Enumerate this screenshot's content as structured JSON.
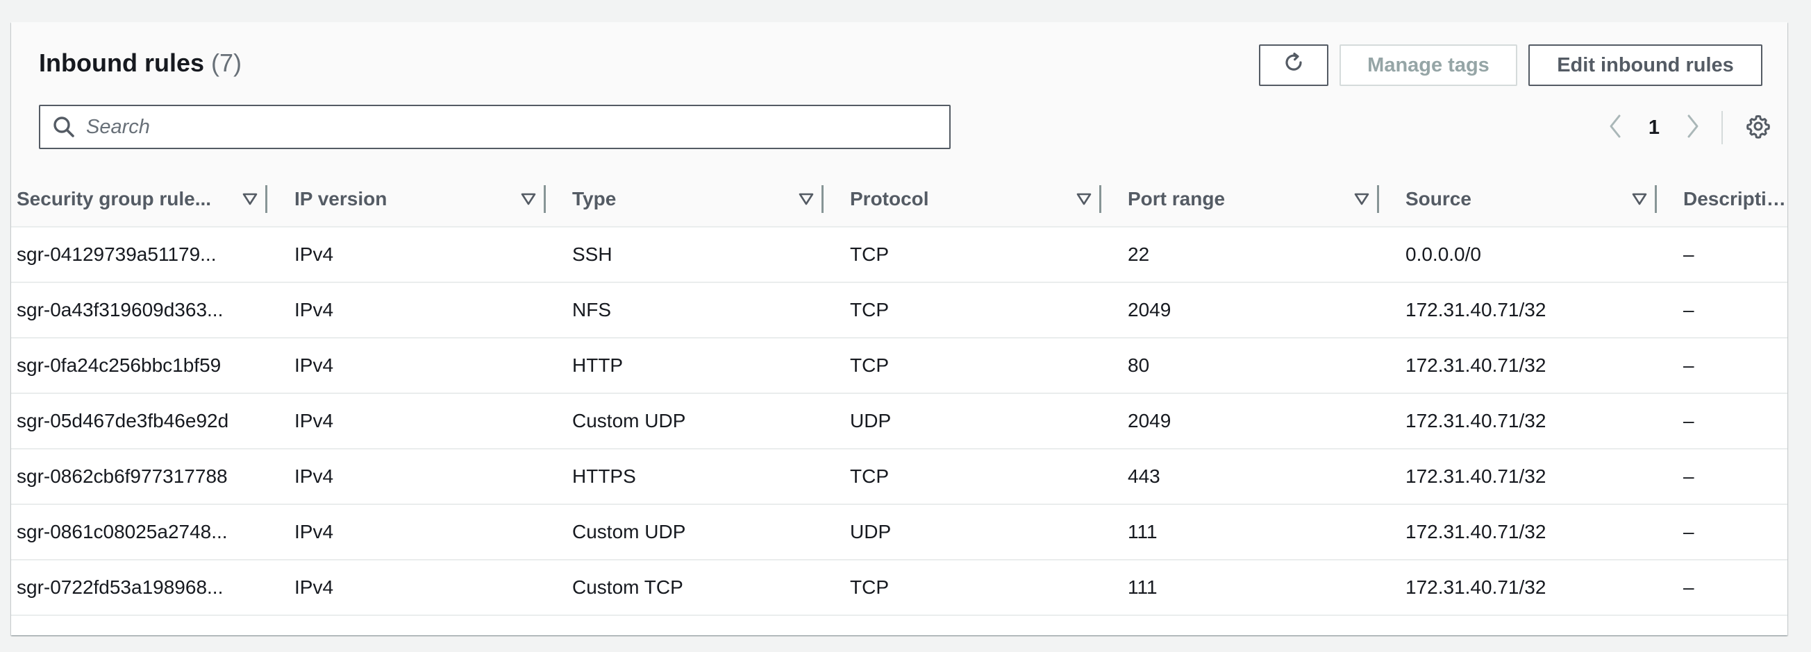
{
  "panel": {
    "title": "Inbound rules",
    "count": "(7)",
    "buttons": {
      "refresh_icon": "refresh-icon",
      "manage_tags": "Manage tags",
      "edit_inbound_rules": "Edit inbound rules"
    },
    "search": {
      "placeholder": "Search",
      "value": ""
    },
    "pagination": {
      "current_page": "1"
    }
  },
  "table": {
    "columns": [
      "Security group rule...",
      "IP version",
      "Type",
      "Protocol",
      "Port range",
      "Source",
      "Description"
    ],
    "rows": [
      [
        "sgr-04129739a51179...",
        "IPv4",
        "SSH",
        "TCP",
        "22",
        "0.0.0.0/0",
        "–"
      ],
      [
        "sgr-0a43f319609d363...",
        "IPv4",
        "NFS",
        "TCP",
        "2049",
        "172.31.40.71/32",
        "–"
      ],
      [
        "sgr-0fa24c256bbc1bf59",
        "IPv4",
        "HTTP",
        "TCP",
        "80",
        "172.31.40.71/32",
        "–"
      ],
      [
        "sgr-05d467de3fb46e92d",
        "IPv4",
        "Custom UDP",
        "UDP",
        "2049",
        "172.31.40.71/32",
        "–"
      ],
      [
        "sgr-0862cb6f977317788",
        "IPv4",
        "HTTPS",
        "TCP",
        "443",
        "172.31.40.71/32",
        "–"
      ],
      [
        "sgr-0861c08025a2748...",
        "IPv4",
        "Custom UDP",
        "UDP",
        "111",
        "172.31.40.71/32",
        "–"
      ],
      [
        "sgr-0722fd53a198968...",
        "IPv4",
        "Custom TCP",
        "TCP",
        "111",
        "172.31.40.71/32",
        "–"
      ]
    ]
  },
  "colors": {
    "text": "#16191f",
    "secondary_text": "#545b64",
    "disabled_text": "#95a5a6",
    "header_bg": "#fafafa",
    "page_bg": "#f2f3f3"
  }
}
